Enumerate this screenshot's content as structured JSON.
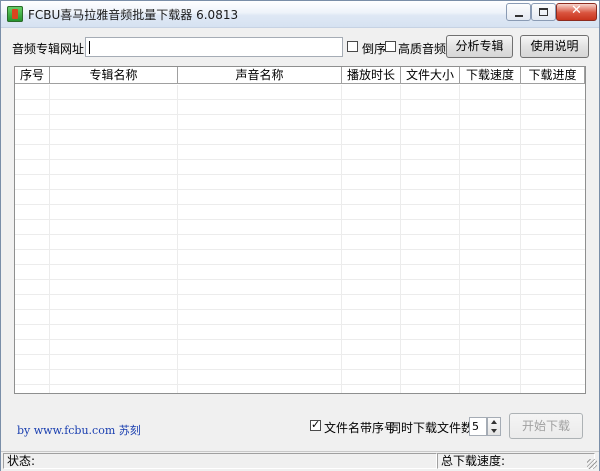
{
  "window": {
    "title": "FCBU喜马拉雅音频批量下载器 6.0813",
    "close_glyph": "✕"
  },
  "toolbar": {
    "url_label": "音频专辑网址:",
    "url_value": "",
    "reverse_label": "倒序",
    "reverse_checked": false,
    "hq_label": "高质音频",
    "hq_checked": false,
    "analyze_button": "分析专辑",
    "help_button": "使用说明"
  },
  "table": {
    "columns": [
      "序号",
      "专辑名称",
      "声音名称",
      "播放时长",
      "文件大小",
      "下载速度",
      "下载进度"
    ],
    "rows": []
  },
  "footer": {
    "credit": "by www.fcbu.com 苏刻",
    "prefix_label": "文件名带序号",
    "prefix_checked": true,
    "concurrent_label": "同时下载文件数:",
    "concurrent_value": "5",
    "start_button": "开始下载",
    "start_enabled": false
  },
  "statusbar": {
    "status_label": "状态:",
    "speed_label": "总下载速度:"
  },
  "colors": {
    "credit": "#1a3fb0",
    "close_button": "#c8341d",
    "window_bg": "#f0f0f0"
  }
}
